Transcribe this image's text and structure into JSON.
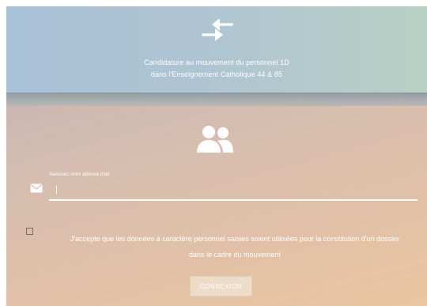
{
  "header": {
    "title_line1": "Candidature au mouvement du personnel 1D",
    "title_line2": "dans l'Enseignement Catholique 44 & 85",
    "logo_icon": "swap-arrows-icon"
  },
  "form": {
    "avatar_icon": "users-icon",
    "email_label": "Saisissez votre adresse mail",
    "email_value": "",
    "email_icon": "envelope-icon",
    "consent_line1": "J'accepte que les données à caractère personnel saisies soient utilisées pour la constitution d'un dossier",
    "consent_line2": "dans le cadre du mouvement",
    "consent_checked": false,
    "submit_label": "CONNEXION"
  },
  "colors": {
    "header_bg": "#afc4d3",
    "body_bg": "#e1c0a7",
    "text": "#ffffff"
  }
}
